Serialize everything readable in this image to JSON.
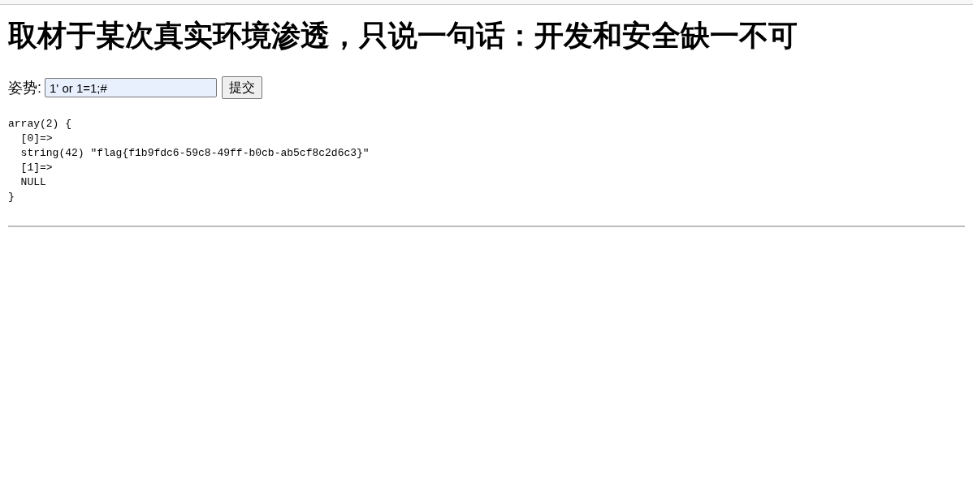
{
  "heading": "取材于某次真实环境渗透，只说一句话：开发和安全缺一不可",
  "form": {
    "label": "姿势:",
    "input": {
      "value": "1' or 1=1;#",
      "autofilled": true
    },
    "submit": "提交"
  },
  "output": [
    "array(2) {",
    "  [0]=>",
    "  string(42) \"flag{f1b9fdc6-59c8-49ff-b0cb-ab5cf8c2d6c3}\"",
    "  [1]=>",
    "  NULL",
    "}"
  ]
}
